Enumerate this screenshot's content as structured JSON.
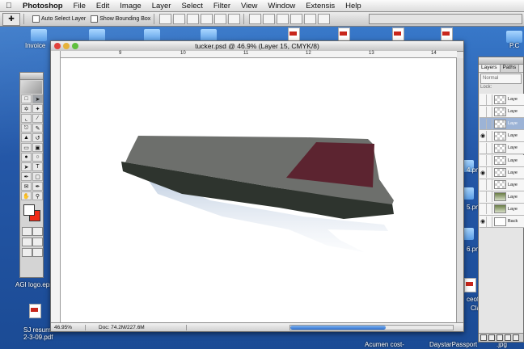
{
  "menubar": {
    "app": "Photoshop",
    "items": [
      "File",
      "Edit",
      "Image",
      "Layer",
      "Select",
      "Filter",
      "View",
      "Window",
      "Extensis",
      "Help"
    ]
  },
  "options_bar": {
    "auto_select_label": "Auto Select Layer",
    "bounding_box_label": "Show Bounding Box"
  },
  "desktop_icons": [
    {
      "label": "Invoice",
      "icon": "folder-icon"
    },
    {
      "label": "AGI logo.eps",
      "icon": "eps-file-icon"
    },
    {
      "label": "SJ resum",
      "icon": "pdf-file-icon"
    },
    {
      "label": "2-3-09.pdf",
      "icon": "pdf-file-icon"
    },
    {
      "label": "P.C",
      "icon": "folder-icon"
    },
    {
      "label": "4.pn",
      "icon": "png-file-icon"
    },
    {
      "label": "5.pn",
      "icon": "png-file-icon"
    },
    {
      "label": "6.pn",
      "icon": "png-file-icon"
    },
    {
      "label": "Acumen cost-",
      "icon": "file-icon"
    },
    {
      "label": "DaystarPassport",
      "icon": "file-icon"
    },
    {
      "label": ".jpg",
      "icon": "jpg-file-icon"
    },
    {
      "label": "Clai",
      "icon": "pdf-file-icon"
    },
    {
      "label": "ceof",
      "icon": "pdf-file-icon"
    }
  ],
  "document": {
    "title": "tucker.psd @ 46.9% (Layer 15, CMYK/8)",
    "ruler_ticks": [
      "9",
      "10",
      "11",
      "12",
      "13",
      "14"
    ],
    "zoom": "46.95%",
    "doc_size": "Doc: 74.2M/227.6M"
  },
  "colors": {
    "foreground": "#ffffff",
    "background": "#f02a17",
    "accent_scroll": "#2d6fd0"
  },
  "layers_panel": {
    "tabs": [
      "Layers",
      "Paths"
    ],
    "blend_mode": "Normal",
    "lock_label": "Lock:",
    "rows": [
      {
        "name": "Laye",
        "visible": false,
        "thumb": "transparent",
        "selected": false
      },
      {
        "name": "Laye",
        "visible": false,
        "thumb": "transparent",
        "selected": false
      },
      {
        "name": "Laye",
        "visible": false,
        "thumb": "transparent",
        "selected": true
      },
      {
        "name": "Laye",
        "visible": true,
        "thumb": "transparent",
        "selected": false
      },
      {
        "name": "Laye",
        "visible": false,
        "thumb": "transparent",
        "selected": false
      },
      {
        "name": "Laye",
        "visible": false,
        "thumb": "transparent",
        "selected": false
      },
      {
        "name": "Laye",
        "visible": true,
        "thumb": "transparent",
        "selected": false
      },
      {
        "name": "Laye",
        "visible": false,
        "thumb": "transparent",
        "selected": false
      },
      {
        "name": "Laye",
        "visible": false,
        "thumb": "image",
        "selected": false
      },
      {
        "name": "Laye",
        "visible": false,
        "thumb": "image",
        "selected": false
      },
      {
        "name": "Back",
        "visible": true,
        "thumb": "white",
        "selected": false
      }
    ]
  }
}
